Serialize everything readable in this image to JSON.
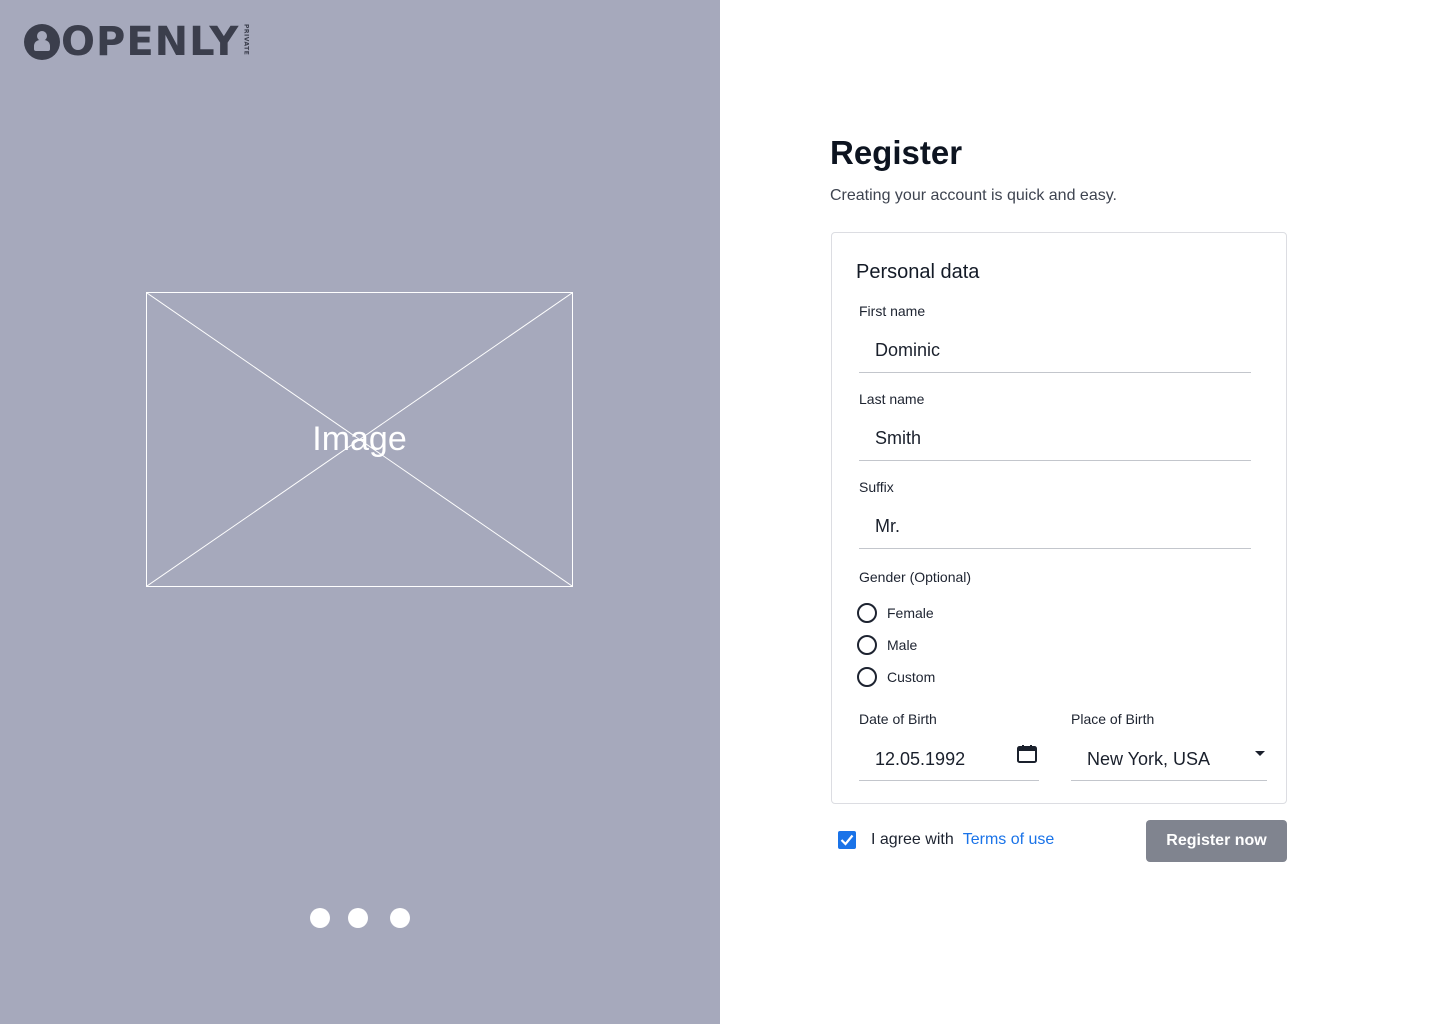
{
  "brand": {
    "name": "OPENLY",
    "tag": "PRIVATE",
    "icon": "person-circle-icon"
  },
  "hero": {
    "image_label": "Image",
    "carousel_dots": 3
  },
  "header": {
    "title": "Register",
    "subtitle": "Creating your account is quick and easy."
  },
  "form": {
    "section_title": "Personal data",
    "first_name": {
      "label": "First name",
      "value": "Dominic"
    },
    "last_name": {
      "label": "Last name",
      "value": "Smith"
    },
    "suffix": {
      "label": "Suffix",
      "value": "Mr."
    },
    "gender": {
      "label": "Gender (Optional)",
      "options": [
        "Female",
        "Male",
        "Custom"
      ]
    },
    "date_of_birth": {
      "label": "Date of Birth",
      "value": "12.05.1992",
      "icon": "calendar-icon"
    },
    "place_of_birth": {
      "label": "Place of Birth",
      "value": "New York, USA",
      "icon": "caret-down-icon"
    }
  },
  "agreement": {
    "checked": true,
    "text": "I agree with",
    "link_text": "Terms of use"
  },
  "actions": {
    "register_label": "Register now"
  },
  "colors": {
    "left_panel_bg": "#a6a9bc",
    "logo": "#3b3e4c",
    "accent": "#1a73e8",
    "button_disabled": "#80848f"
  }
}
